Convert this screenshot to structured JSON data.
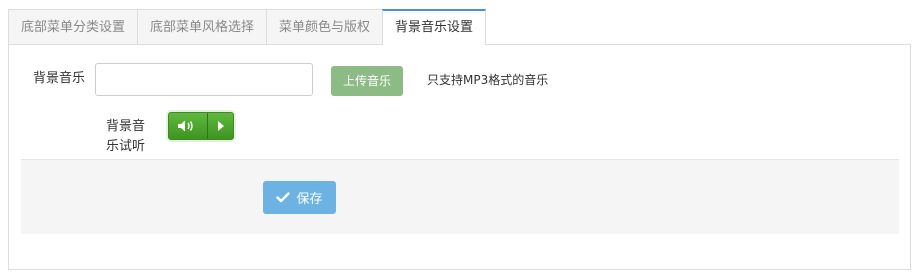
{
  "tabs": [
    {
      "label": "底部菜单分类设置",
      "active": false
    },
    {
      "label": "底部菜单风格选择",
      "active": false
    },
    {
      "label": "菜单颜色与版权",
      "active": false
    },
    {
      "label": "背景音乐设置",
      "active": true
    }
  ],
  "form": {
    "bg_music_label": "背景音乐",
    "bg_music_value": "",
    "upload_button": "上传音乐",
    "hint": "只支持MP3格式的音乐",
    "preview_label": "背景音乐试听"
  },
  "player": {
    "volume_icon": "volume-icon",
    "play_icon": "play-icon"
  },
  "footer": {
    "save_button": "保存",
    "save_icon": "check-icon"
  },
  "colors": {
    "active_tab_accent": "#4a90d9",
    "upload_button": "#8cbb85",
    "player_green": "#4caa2c",
    "save_button": "#6cb3e3"
  }
}
